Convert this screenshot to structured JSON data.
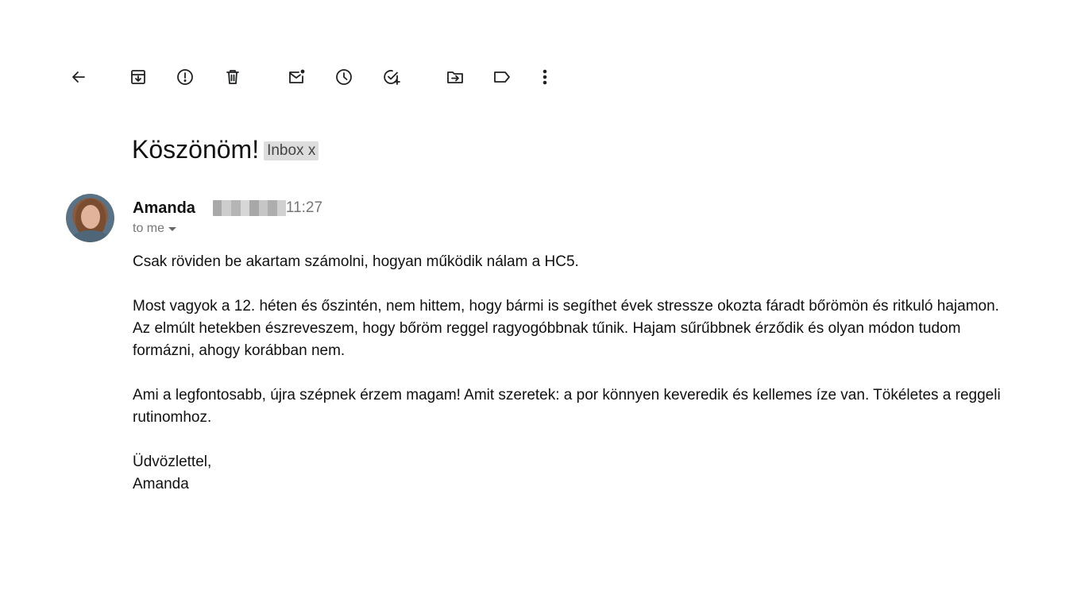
{
  "toolbar": {
    "back_icon": "arrow-left-icon",
    "archive_icon": "archive-icon",
    "spam_icon": "report-spam-icon",
    "delete_icon": "trash-icon",
    "mark_unread_icon": "mark-unread-icon",
    "snooze_icon": "clock-icon",
    "add_task_icon": "add-task-icon",
    "move_icon": "move-to-folder-icon",
    "label_icon": "label-icon",
    "more_icon": "more-vertical-icon"
  },
  "email": {
    "subject": "Köszönöm!",
    "label": "Inbox x",
    "sender": "Amanda",
    "time": "11:27",
    "recipient": "to me",
    "body": [
      "Csak röviden be akartam számolni, hogyan működik nálam a HC5.",
      "Most vagyok a 12. héten és őszintén, nem hittem, hogy bármi is segíthet évek stressze okozta fáradt bőrömön és ritkuló hajamon. Az elmúlt hetekben észreveszem, hogy bőröm reggel ragyogóbbnak tűnik. Hajam sűrűbbnek érződik és olyan módon tudom formázni, ahogy korábban nem.",
      "Ami a legfontosabb, újra szépnek érzem magam! Amit szeretek: a por könnyen keveredik és kellemes íze van. Tökéletes a reggeli rutinomhoz."
    ],
    "closing": "Üdvözlettel,",
    "signature": "Amanda"
  },
  "colors": {
    "text": "#202124",
    "muted": "#777777",
    "label_bg": "#dddddd"
  }
}
